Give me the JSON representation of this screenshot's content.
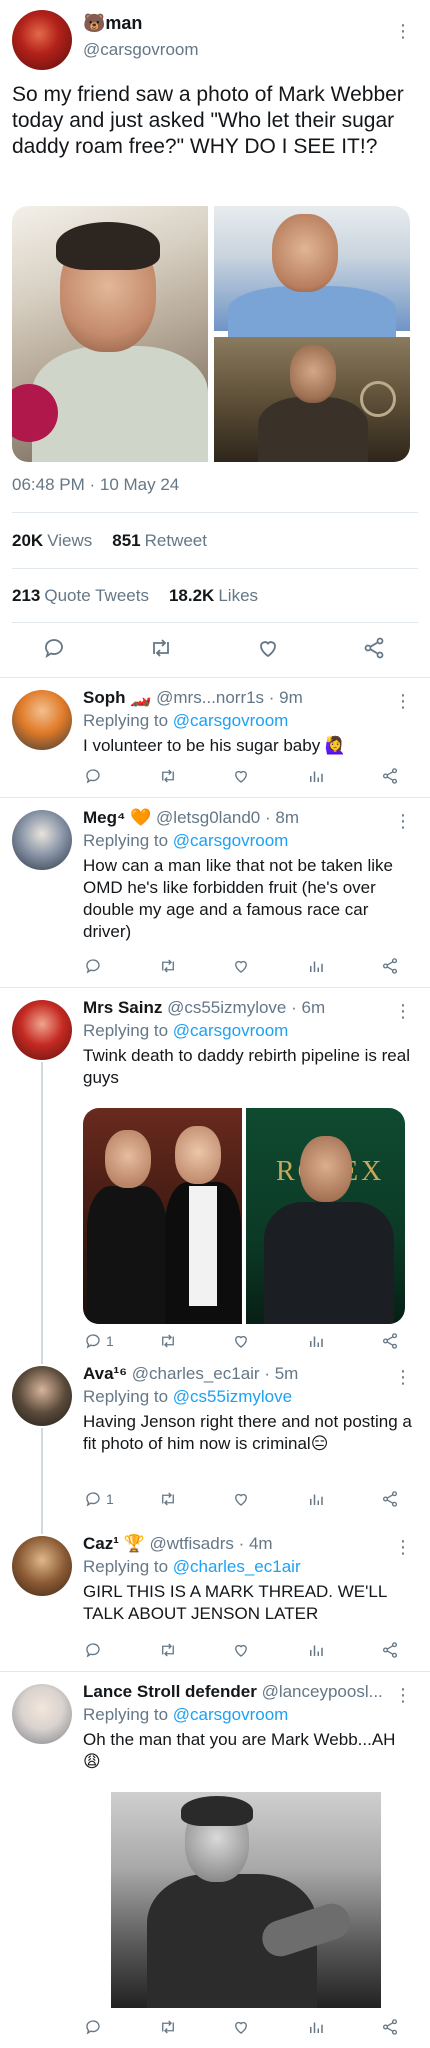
{
  "main_tweet": {
    "display_name": "🐻man",
    "handle": "@carsgovroom",
    "text": "So my friend saw a photo of Mark Webber today and just asked \"Who let their sugar daddy roam free?\" WHY DO I SEE IT!?",
    "timestamp": "06:48 PM · 10 May 24",
    "views_count": "20K",
    "views_label": "Views",
    "retweets_count": "851",
    "retweets_label": "Retweet",
    "quotes_count": "213",
    "quotes_label": "Quote Tweets",
    "likes_count": "18.2K",
    "likes_label": "Likes",
    "more_glyph": "⋮"
  },
  "replies": [
    {
      "name": "Soph 🏎️",
      "handle": "@mrs...norr1s",
      "time": "· 9m",
      "replying_prefix": "Replying to",
      "replying_to": "@carsgovroom",
      "text": "I volunteer to be his sugar baby 🙋‍♀️",
      "reply_count": ""
    },
    {
      "name": "Meg⁴ 🧡",
      "handle": "@letsg0land0",
      "time": "· 8m",
      "replying_prefix": "Replying to",
      "replying_to": "@carsgovroom",
      "text": "How can a man like that not be taken like OMD he's like forbidden fruit (he's over double my age and a famous race car driver)",
      "reply_count": ""
    },
    {
      "name": "Mrs Sainz",
      "handle": "@cs55izmylove",
      "time": "· 6m",
      "replying_prefix": "Replying to",
      "replying_to": "@carsgovroom",
      "text": "Twink death to daddy rebirth pipeline is real guys",
      "reply_count": "1",
      "media_text": "ROLEX"
    },
    {
      "name": "Ava¹⁶",
      "handle": "@charles_ec1air",
      "time": "· 5m",
      "replying_prefix": "Replying to",
      "replying_to": "@cs55izmylove",
      "text": "Having Jenson right there and not posting a fit photo of him now is criminal😑",
      "reply_count": "1"
    },
    {
      "name": "Caz¹ 🏆",
      "handle": "@wtfisadrs",
      "time": "· 4m",
      "replying_prefix": "Replying to",
      "replying_to": "@charles_ec1air",
      "text": "GIRL THIS IS A MARK THREAD. WE'LL TALK ABOUT JENSON LATER",
      "reply_count": ""
    },
    {
      "name": "Lance Stroll defender",
      "handle": "@lanceypoosl...",
      "time": "",
      "replying_prefix": "Replying to",
      "replying_to": "@carsgovroom",
      "text": "Oh the man that you are Mark Webb...AH😩",
      "reply_count": ""
    }
  ],
  "icons": {
    "reply": "reply-icon",
    "retweet": "retweet-icon",
    "like": "heart-icon",
    "analytics": "analytics-icon",
    "share": "share-icon",
    "more": "more-icon"
  },
  "colors": {
    "accent": "#1da1f2",
    "muted": "#657786",
    "divider": "#e1e8ed"
  }
}
